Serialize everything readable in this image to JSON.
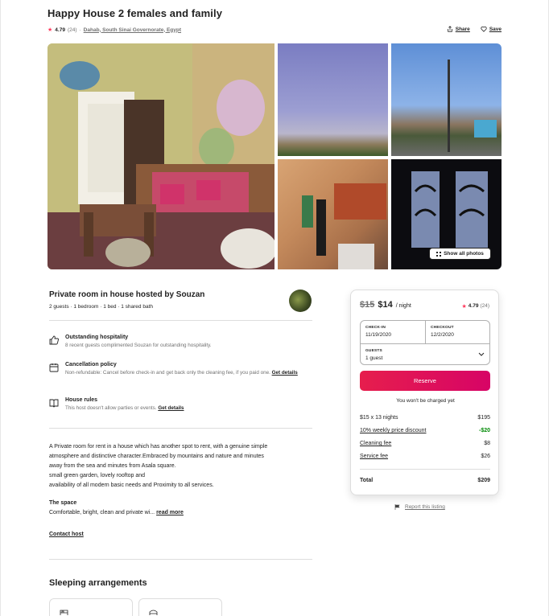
{
  "listing": {
    "title": "Happy House 2 females and family",
    "rating": "4.79",
    "reviews": "(24)",
    "separator": "·",
    "location": "Dahab, South Sinai Governorate, Egypt",
    "share_label": "Share",
    "save_label": "Save"
  },
  "gallery": {
    "show_all_label": "Show all photos"
  },
  "host": {
    "title": "Private room in house hosted by Souzan",
    "summary": "2 guests · 1 bedroom · 1 bed · 1 shared bath"
  },
  "features": [
    {
      "title": "Outstanding hospitality",
      "desc": "8 recent guests complimented Souzan for outstanding hospitality.",
      "icon": "thumbs-up-icon"
    },
    {
      "title": "Cancellation policy",
      "desc": "Non-refundable: Cancel before check-in and get back only the cleaning fee, if you paid one.",
      "link": "Get details",
      "icon": "calendar-icon"
    },
    {
      "title": "House rules",
      "desc": "This host doesn't allow parties or events.",
      "link": "Get details",
      "icon": "book-icon"
    }
  ],
  "description": {
    "lines": [
      "A Private room for rent in a house which has another spot to rent, with a genuine simple",
      "atmosphere and distinctive character.Embraced by mountains and nature and minutes",
      "away from the sea and minutes from Asala square.",
      "small green garden, lovely rooftop and",
      "availability of all modern basic needs and Proximity to all services."
    ],
    "space_title": "The space",
    "space_text": "Comfortable, bright, clean and private wi...",
    "read_more": "read more",
    "contact": "Contact host"
  },
  "sleeping": {
    "title": "Sleeping arrangements"
  },
  "booking": {
    "old_price": "$15",
    "price": "$14",
    "per_night": "/ night",
    "rating": "4.79",
    "reviews": "(24)",
    "checkin_label": "CHECK-IN",
    "checkin_value": "11/19/2020",
    "checkout_label": "CHECKOUT",
    "checkout_value": "12/2/2020",
    "guests_label": "GUESTS",
    "guests_value": "1 guest",
    "reserve_label": "Reserve",
    "no_charge": "You won't be charged yet",
    "rows": [
      {
        "label": "$15 x 13 nights",
        "value": "$195"
      },
      {
        "label": "10% weekly price discount",
        "value": "-$20"
      },
      {
        "label": "Cleaning fee",
        "value": "$8"
      },
      {
        "label": "Service fee",
        "value": "$26"
      }
    ],
    "total_label": "Total",
    "total_value": "$209",
    "accent": "#e61e4d",
    "discount_color": "#008a05"
  },
  "report": {
    "label": "Report this listing"
  }
}
